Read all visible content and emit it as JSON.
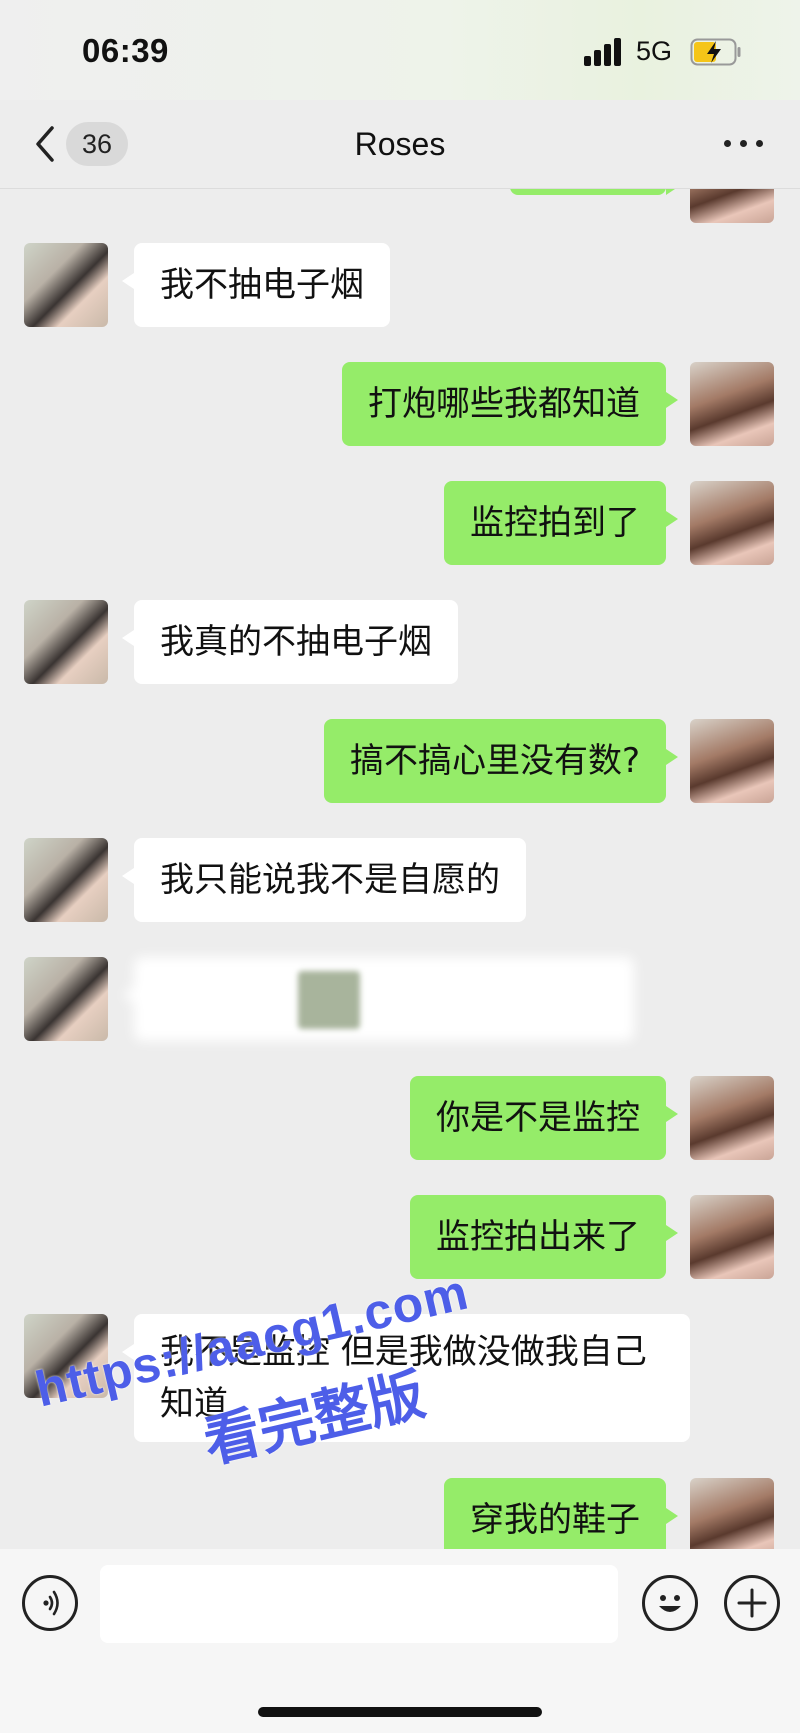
{
  "status_bar": {
    "time": "06:39",
    "network": "5G"
  },
  "nav": {
    "unread_count": "36",
    "title": "Roses"
  },
  "messages": [
    {
      "side": "left",
      "text": "我不抽电子烟"
    },
    {
      "side": "right",
      "text": "打炮哪些我都知道"
    },
    {
      "side": "right",
      "text": "监控拍到了"
    },
    {
      "side": "left",
      "text": "我真的不抽电子烟"
    },
    {
      "side": "right",
      "text": "搞不搞心里没有数?"
    },
    {
      "side": "left",
      "text": "我只能说我不是自愿的"
    },
    {
      "side": "left",
      "text": ""
    },
    {
      "side": "right",
      "text": "你是不是监控"
    },
    {
      "side": "right",
      "text": "监控拍出来了"
    },
    {
      "side": "left",
      "text": "我不是监控 但是我做没做我自己\n知道"
    },
    {
      "side": "right",
      "text": "穿我的鞋子"
    }
  ],
  "watermark": {
    "url": "https://aacg1.com",
    "caption": "看完整版"
  },
  "input": {
    "value": ""
  },
  "icons": {
    "back": "chevron-left-icon",
    "more": "more-dots-icon",
    "voice": "voice-icon",
    "emoji": "emoji-icon",
    "plus": "plus-icon"
  },
  "colors": {
    "outgoing_bubble": "#95ec69",
    "incoming_bubble": "#ffffff",
    "background": "#ededed"
  }
}
